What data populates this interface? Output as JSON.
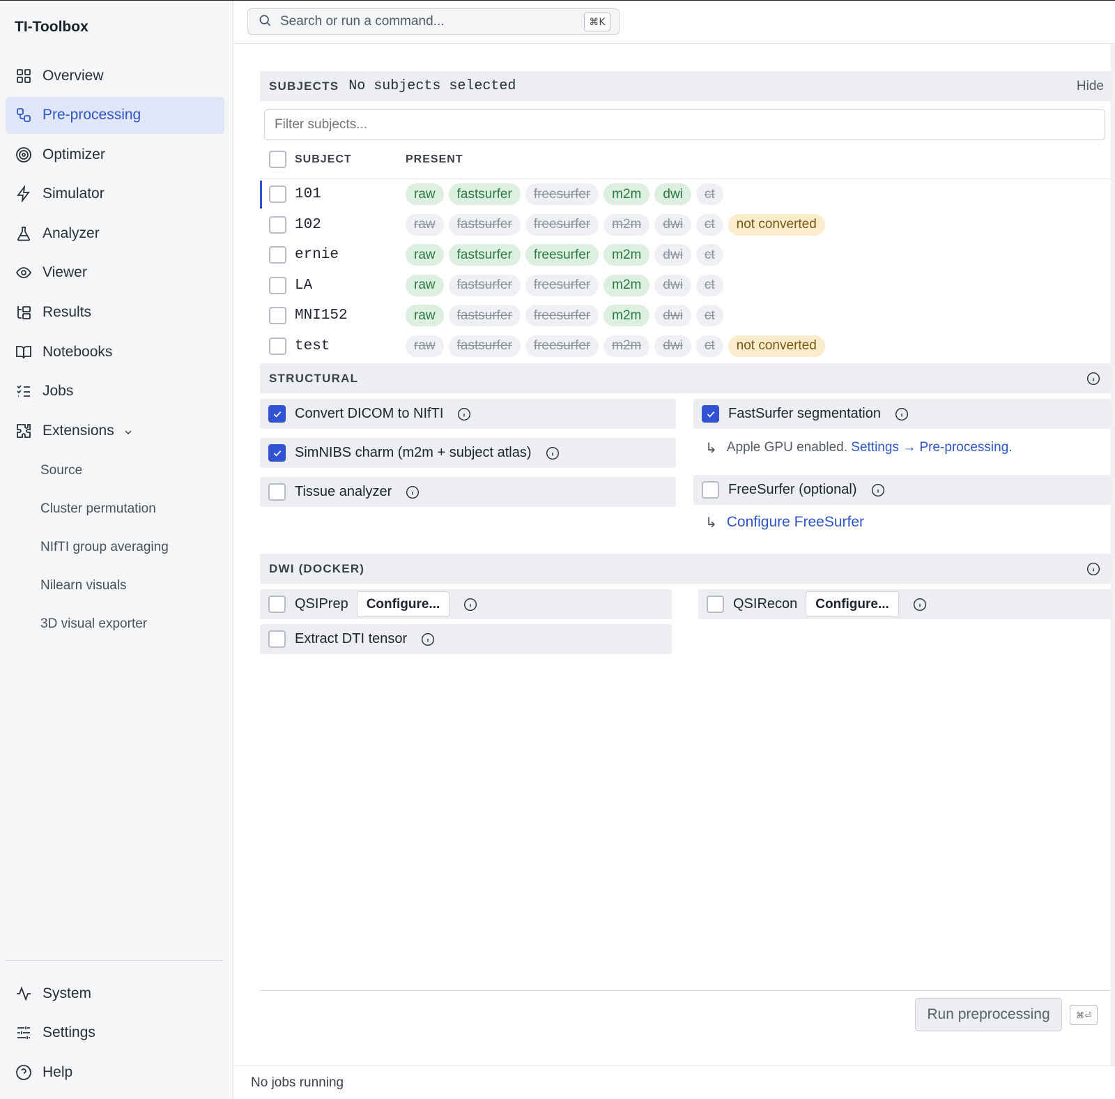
{
  "app": {
    "title": "TI-Toolbox"
  },
  "search": {
    "placeholder": "Search or run a command...",
    "shortcut": "⌘K"
  },
  "nav": {
    "items": [
      {
        "label": "Overview",
        "icon": "grid-icon"
      },
      {
        "label": "Pre-processing",
        "icon": "workflow-icon",
        "active": true
      },
      {
        "label": "Optimizer",
        "icon": "target-icon"
      },
      {
        "label": "Simulator",
        "icon": "lightning-icon"
      },
      {
        "label": "Analyzer",
        "icon": "flask-icon"
      },
      {
        "label": "Viewer",
        "icon": "eye-icon"
      },
      {
        "label": "Results",
        "icon": "folder-tree-icon"
      },
      {
        "label": "Notebooks",
        "icon": "book-icon"
      },
      {
        "label": "Jobs",
        "icon": "list-checks-icon"
      },
      {
        "label": "Extensions",
        "icon": "puzzle-icon"
      }
    ],
    "extensions": [
      "Source",
      "Cluster permutation",
      "NIfTI group averaging",
      "Nilearn visuals",
      "3D visual exporter"
    ],
    "bottom": [
      {
        "label": "System",
        "icon": "activity-icon"
      },
      {
        "label": "Settings",
        "icon": "sliders-icon"
      },
      {
        "label": "Help",
        "icon": "help-circle-icon"
      }
    ]
  },
  "subjects": {
    "title": "SUBJECTS",
    "status": "No subjects selected",
    "hide": "Hide",
    "filter_placeholder": "Filter subjects...",
    "col_subject": "SUBJECT",
    "col_present": "PRESENT",
    "rows": [
      {
        "id": "101",
        "tags": [
          [
            "raw",
            "on"
          ],
          [
            "fastsurfer",
            "on"
          ],
          [
            "freesurfer",
            "off"
          ],
          [
            "m2m",
            "on"
          ],
          [
            "dwi",
            "on"
          ],
          [
            "ct",
            "off"
          ]
        ],
        "marked": true
      },
      {
        "id": "102",
        "tags": [
          [
            "raw",
            "off"
          ],
          [
            "fastsurfer",
            "off"
          ],
          [
            "freesurfer",
            "off"
          ],
          [
            "m2m",
            "off"
          ],
          [
            "dwi",
            "off"
          ],
          [
            "ct",
            "off"
          ],
          [
            "not converted",
            "warn"
          ]
        ]
      },
      {
        "id": "ernie",
        "tags": [
          [
            "raw",
            "on"
          ],
          [
            "fastsurfer",
            "on"
          ],
          [
            "freesurfer",
            "on"
          ],
          [
            "m2m",
            "on"
          ],
          [
            "dwi",
            "off"
          ],
          [
            "ct",
            "off"
          ]
        ]
      },
      {
        "id": "LA",
        "tags": [
          [
            "raw",
            "on"
          ],
          [
            "fastsurfer",
            "off"
          ],
          [
            "freesurfer",
            "off"
          ],
          [
            "m2m",
            "on"
          ],
          [
            "dwi",
            "off"
          ],
          [
            "ct",
            "off"
          ]
        ]
      },
      {
        "id": "MNI152",
        "tags": [
          [
            "raw",
            "on"
          ],
          [
            "fastsurfer",
            "off"
          ],
          [
            "freesurfer",
            "off"
          ],
          [
            "m2m",
            "on"
          ],
          [
            "dwi",
            "off"
          ],
          [
            "ct",
            "off"
          ]
        ]
      },
      {
        "id": "test",
        "tags": [
          [
            "raw",
            "off"
          ],
          [
            "fastsurfer",
            "off"
          ],
          [
            "freesurfer",
            "off"
          ],
          [
            "m2m",
            "off"
          ],
          [
            "dwi",
            "off"
          ],
          [
            "ct",
            "off"
          ],
          [
            "not converted",
            "warn"
          ]
        ]
      }
    ]
  },
  "structural": {
    "title": "STRUCTURAL",
    "convert_dicom": "Convert DICOM to NIfTI",
    "fastsurfer": "FastSurfer segmentation",
    "fastsurfer_note": "Apple GPU enabled.",
    "fastsurfer_link": "Settings → Pre-processing",
    "fastsurfer_note_end": ".",
    "simnibs": "SimNIBS charm (m2m + subject atlas)",
    "freesurfer": "FreeSurfer (optional)",
    "tissue": "Tissue analyzer",
    "configure_freesurfer": "Configure FreeSurfer"
  },
  "dwi": {
    "title": "DWI (DOCKER)",
    "qsiprep": "QSIPrep",
    "qsirecon": "QSIRecon",
    "configure": "Configure...",
    "extract_dti": "Extract DTI tensor"
  },
  "actions": {
    "run": "Run preprocessing",
    "run_shortcut": "⌘⏎"
  },
  "status": {
    "jobs": "No jobs running"
  },
  "colors": {
    "accent": "#3252d4",
    "present": "#2b7a42",
    "warning": "#7a5516"
  }
}
